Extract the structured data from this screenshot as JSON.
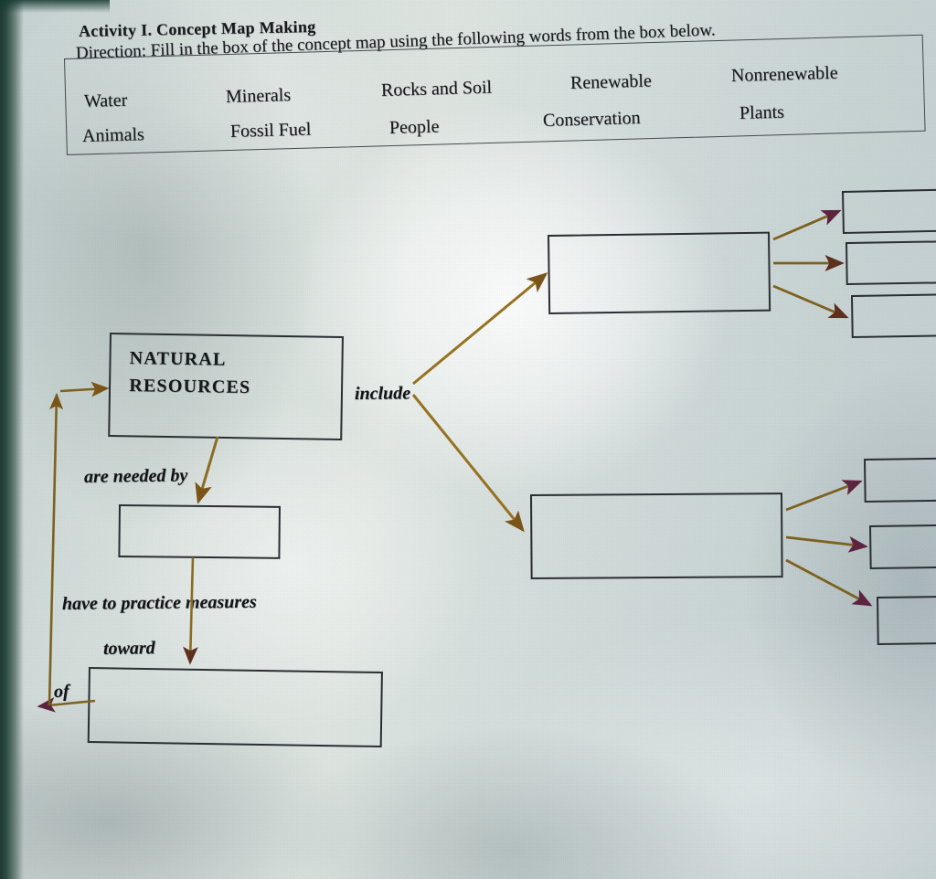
{
  "worksheet": {
    "activity_title": "Activity I.  Concept Map Making",
    "direction": "Direction: Fill in the box of the concept map using the following words from the box below."
  },
  "word_box": {
    "row1": [
      "Water",
      "Minerals",
      "Rocks and Soil",
      "Renewable",
      "Nonrenewable"
    ],
    "row2": [
      "Animals",
      "Fossil Fuel",
      "People",
      "Conservation",
      "Plants"
    ]
  },
  "concept_map": {
    "root_box": {
      "line1": "NATURAL",
      "line2": "RESOURCES"
    },
    "connector_labels": {
      "include": "include",
      "are_needed_by": "are needed by",
      "have_to_practice": "have to practice measures",
      "toward": "toward",
      "of": "of"
    },
    "blank_boxes": {
      "include_upper": "",
      "include_lower": "",
      "needed_by": "",
      "measures": "",
      "upper_branch_1": "",
      "upper_branch_2": "",
      "upper_branch_3": "",
      "lower_branch_1": "",
      "lower_branch_2": "",
      "lower_branch_3": ""
    }
  },
  "colors": {
    "ink": "#16181a",
    "box_stroke": "#2a2e33",
    "arrow": "#8a6b24",
    "arrow_head": "#5d3320",
    "paper": "#d5dedb"
  }
}
